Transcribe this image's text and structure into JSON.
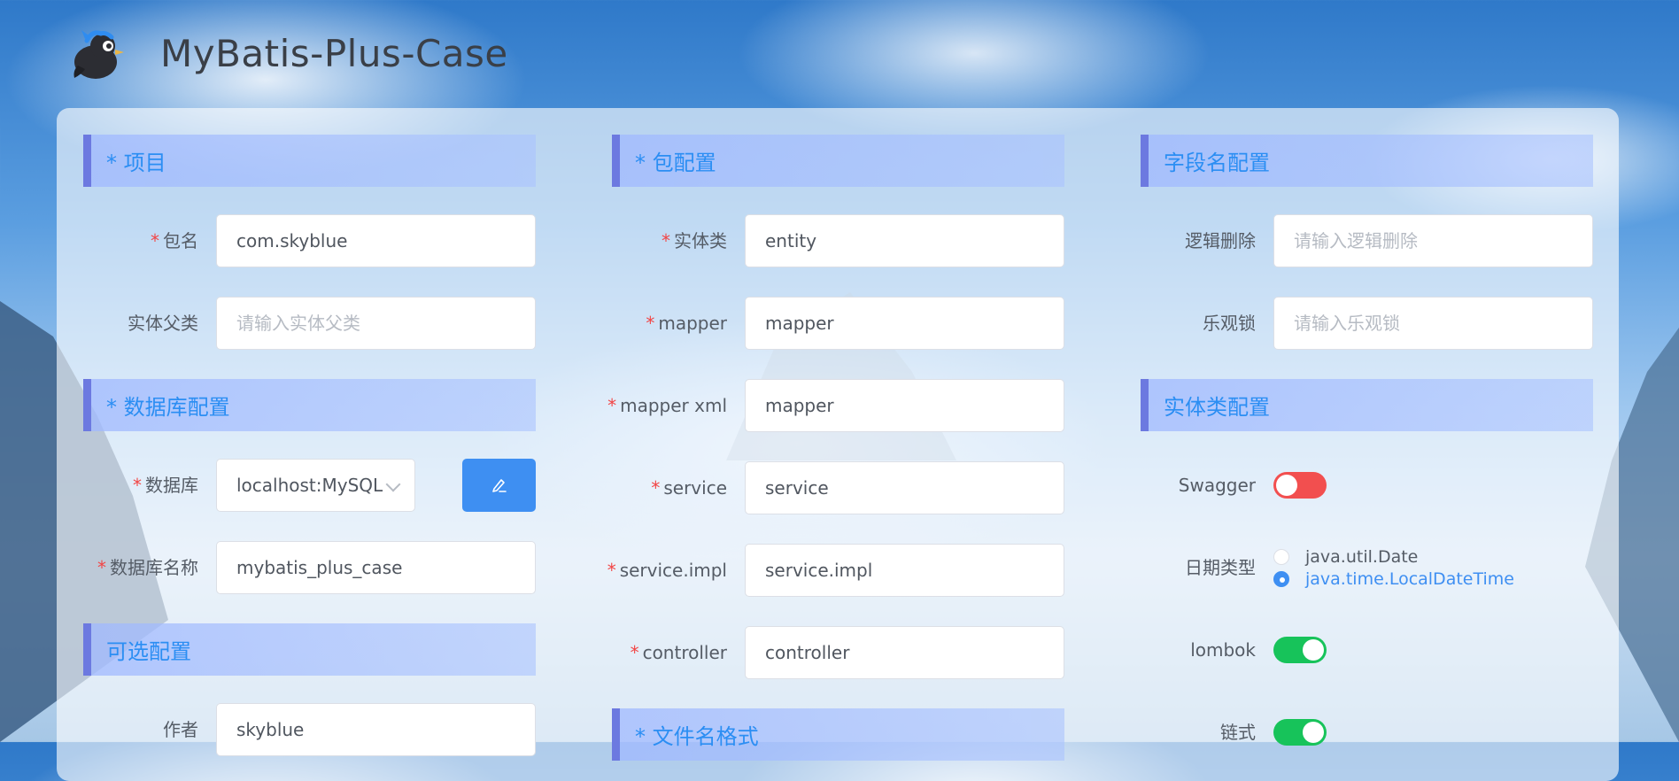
{
  "app": {
    "title": "MyBatis-Plus-Case"
  },
  "sections": {
    "project": "* 项目",
    "database": "* 数据库配置",
    "optional": "可选配置",
    "package": "* 包配置",
    "filename_format": "* 文件名格式",
    "field_name": "字段名配置",
    "entity": "实体类配置"
  },
  "project": {
    "package_name": {
      "label": "包名",
      "required": "*",
      "value": "com.skyblue"
    },
    "entity_parent": {
      "label": "实体父类",
      "placeholder": "请输入实体父类"
    }
  },
  "database": {
    "db": {
      "label": "数据库",
      "required": "*",
      "value": "localhost:MySQL"
    },
    "db_name": {
      "label": "数据库名称",
      "required": "*",
      "value": "mybatis_plus_case"
    }
  },
  "optional": {
    "author": {
      "label": "作者",
      "value": "skyblue"
    }
  },
  "package": {
    "entity": {
      "label": "实体类",
      "required": "*",
      "value": "entity"
    },
    "mapper": {
      "label": "mapper",
      "required": "*",
      "value": "mapper"
    },
    "mapper_xml": {
      "label": "mapper xml",
      "required": "*",
      "value": "mapper"
    },
    "service": {
      "label": "service",
      "required": "*",
      "value": "service"
    },
    "service_impl": {
      "label": "service.impl",
      "required": "*",
      "value": "service.impl"
    },
    "controller": {
      "label": "controller",
      "required": "*",
      "value": "controller"
    }
  },
  "field_name": {
    "logic_delete": {
      "label": "逻辑删除",
      "placeholder": "请输入逻辑删除"
    },
    "optimistic_lock": {
      "label": "乐观锁",
      "placeholder": "请输入乐观锁"
    }
  },
  "entity": {
    "swagger": {
      "label": "Swagger",
      "enabled": false
    },
    "date_type": {
      "label": "日期类型",
      "options": [
        "java.util.Date",
        "java.time.LocalDateTime"
      ],
      "selected": "java.time.LocalDateTime"
    },
    "lombok": {
      "label": "lombok",
      "enabled": true
    },
    "chain": {
      "label": "链式",
      "enabled": true
    }
  },
  "icons": {
    "logo": "bird-logo-icon",
    "edit": "edit-pen-icon",
    "select_arrow": "chevron-down-icon"
  },
  "colors": {
    "accent": "#3e8ff2",
    "section_bar": "#6c79e0",
    "section_text": "#2b8ef3",
    "switch_on": "#17c35a",
    "switch_off": "#f24f4f",
    "required": "#f24545"
  }
}
